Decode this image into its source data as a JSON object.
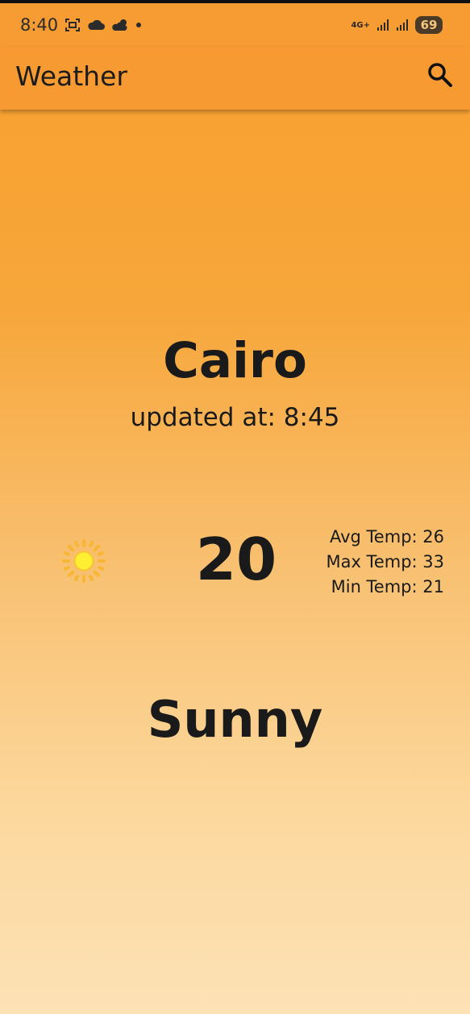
{
  "status_bar": {
    "time": "8:40",
    "network": "4G+",
    "battery": "69",
    "icons_left": [
      "screenshot-icon",
      "cloud-icon",
      "cloud-sun-icon",
      "dot-icon"
    ],
    "icons_right": [
      "network-4g-icon",
      "signal-icon",
      "signal-icon",
      "battery-icon"
    ]
  },
  "app_bar": {
    "title": "Weather",
    "search_icon": "search-icon"
  },
  "weather": {
    "city": "Cairo",
    "updated": "updated at: 8:45",
    "temperature": "20",
    "avg": "Avg Temp: 26",
    "max": "Max Temp: 33",
    "min": "Min Temp: 21",
    "condition": "Sunny",
    "condition_icon": "sun-icon"
  },
  "colors": {
    "gradient_top": "#f8a02f",
    "gradient_bottom": "#fde2b6",
    "app_bar": "#f79a31",
    "text": "#1a1a1a"
  }
}
